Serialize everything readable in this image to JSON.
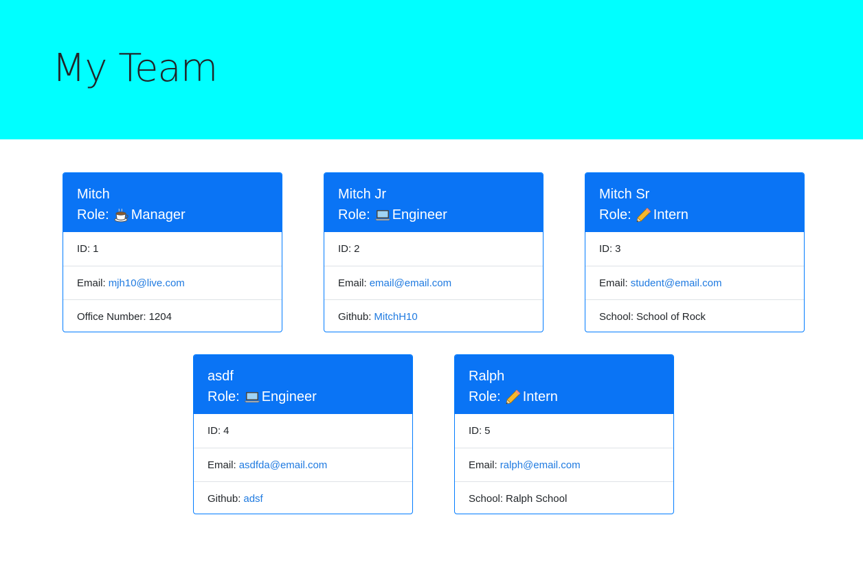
{
  "header": {
    "title": "My Team"
  },
  "cards": [
    {
      "name": "Mitch",
      "role_label": "Role:",
      "role": "Manager",
      "role_icon": "coffee-icon",
      "id_label": "ID:",
      "id": "1",
      "email_label": "Email:",
      "email": "mjh10@live.com",
      "extra_label": "Office Number:",
      "extra": "1204"
    },
    {
      "name": "Mitch Jr",
      "role_label": "Role:",
      "role": "Engineer",
      "role_icon": "laptop-icon",
      "id_label": "ID:",
      "id": "2",
      "email_label": "Email:",
      "email": "email@email.com",
      "extra_label": "Github:",
      "extra": "MitchH10"
    },
    {
      "name": "Mitch Sr",
      "role_label": "Role:",
      "role": "Intern",
      "role_icon": "pencil-icon",
      "id_label": "ID:",
      "id": "3",
      "email_label": "Email:",
      "email": "student@email.com",
      "extra_label": "School:",
      "extra": "School of Rock"
    },
    {
      "name": "asdf",
      "role_label": "Role:",
      "role": "Engineer",
      "role_icon": "laptop-icon",
      "id_label": "ID:",
      "id": "4",
      "email_label": "Email:",
      "email": "asdfda@email.com",
      "extra_label": "Github:",
      "extra": "adsf"
    },
    {
      "name": "Ralph",
      "role_label": "Role:",
      "role": "Intern",
      "role_icon": "pencil-icon",
      "id_label": "ID:",
      "id": "5",
      "email_label": "Email:",
      "email": "ralph@email.com",
      "extra_label": "School:",
      "extra": "Ralph School"
    }
  ],
  "colors": {
    "jumbotron": "#00ffff",
    "card_header": "#0a74f5",
    "card_border": "#007bff",
    "link": "#1f7ae0"
  }
}
